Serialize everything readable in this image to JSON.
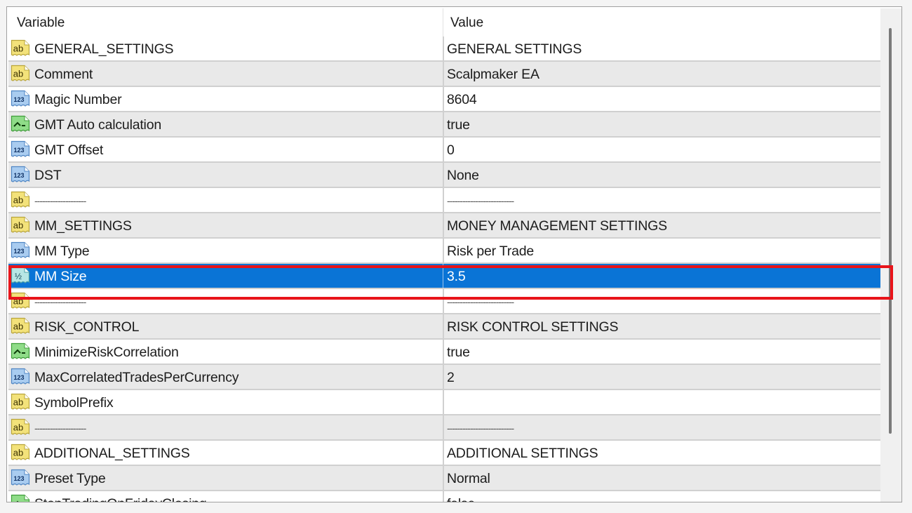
{
  "table": {
    "columns": {
      "variable": "Variable",
      "value": "Value"
    },
    "selected_index": 9,
    "rows": [
      {
        "icon": "string-icon",
        "name": "GENERAL_SETTINGS",
        "value": "GENERAL SETTINGS"
      },
      {
        "icon": "string-icon",
        "name": "Comment",
        "value": "Scalpmaker EA"
      },
      {
        "icon": "integer-icon",
        "name": "Magic Number",
        "value": "8604"
      },
      {
        "icon": "bool-icon",
        "name": "GMT Auto calculation",
        "value": "true"
      },
      {
        "icon": "integer-icon",
        "name": "GMT Offset",
        "value": "0"
      },
      {
        "icon": "integer-icon",
        "name": "DST",
        "value": "None"
      },
      {
        "icon": "string-icon",
        "name": "--------------------",
        "value": "--------------------------"
      },
      {
        "icon": "string-icon",
        "name": "MM_SETTINGS",
        "value": "MONEY MANAGEMENT SETTINGS"
      },
      {
        "icon": "integer-icon",
        "name": "MM Type",
        "value": "Risk per Trade"
      },
      {
        "icon": "double-icon",
        "name": "MM Size",
        "value": "3.5"
      },
      {
        "icon": "string-icon",
        "name": "--------------------",
        "value": "--------------------------"
      },
      {
        "icon": "string-icon",
        "name": "RISK_CONTROL",
        "value": "RISK CONTROL SETTINGS"
      },
      {
        "icon": "bool-icon",
        "name": "MinimizeRiskCorrelation",
        "value": "true"
      },
      {
        "icon": "integer-icon",
        "name": "MaxCorrelatedTradesPerCurrency",
        "value": "2"
      },
      {
        "icon": "string-icon",
        "name": "SymbolPrefix",
        "value": ""
      },
      {
        "icon": "string-icon",
        "name": "--------------------",
        "value": "--------------------------"
      },
      {
        "icon": "string-icon",
        "name": "ADDITIONAL_SETTINGS",
        "value": "ADDITIONAL SETTINGS"
      },
      {
        "icon": "integer-icon",
        "name": "Preset Type",
        "value": "Normal"
      },
      {
        "icon": "bool-icon",
        "name": "StopTradingOnFridayClosing",
        "value": "false"
      }
    ]
  },
  "icons": {
    "string-icon": {
      "glyph": "ab",
      "fill": "#f3e27a",
      "stroke": "#b9a53a",
      "text": "#3a3000"
    },
    "integer-icon": {
      "glyph": "123",
      "fill": "#a9ccf0",
      "stroke": "#4f86c4",
      "text": "#0d2f63"
    },
    "double-icon": {
      "glyph": "½",
      "fill": "#b7e6e4",
      "stroke": "#4aa0a6",
      "text": "#0b3d4d"
    },
    "bool-icon": {
      "glyph": "toggle",
      "fill": "#8fdc88",
      "stroke": "#3f9d3a",
      "text": "#0d3d0a"
    }
  },
  "colors": {
    "selection": "#0a74d6",
    "highlight_box": "#e8141a",
    "row_alt": "#e9e9e9"
  }
}
